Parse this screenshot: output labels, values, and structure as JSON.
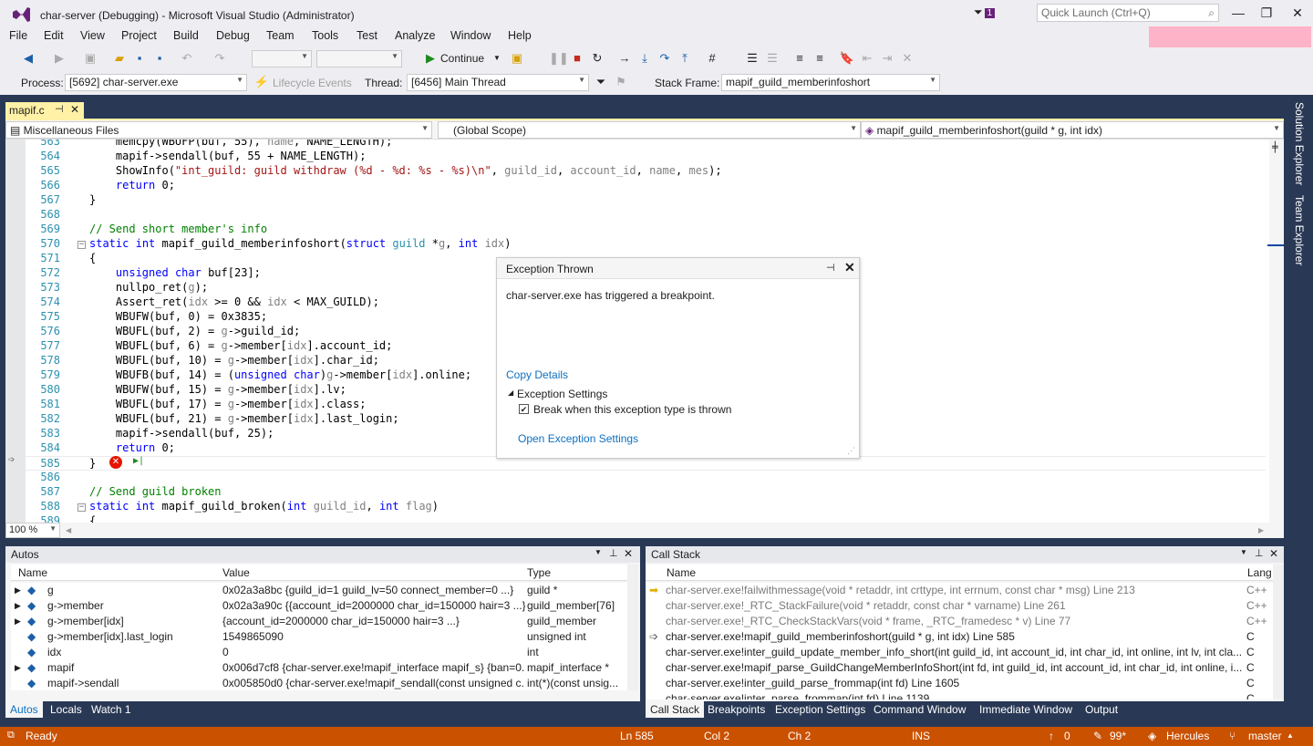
{
  "window": {
    "title": "char-server (Debugging) - Microsoft Visual Studio  (Administrator)",
    "notifications_badge": "1",
    "quick_launch_placeholder": "Quick Launch (Ctrl+Q)"
  },
  "menu": [
    "File",
    "Edit",
    "View",
    "Project",
    "Build",
    "Debug",
    "Team",
    "Tools",
    "Test",
    "Analyze",
    "Window",
    "Help"
  ],
  "toolbar": {
    "continue_label": "Continue",
    "process_label": "Process:",
    "process_value": "[5692] char-server.exe",
    "lifecycle_label": "Lifecycle Events",
    "thread_label": "Thread:",
    "thread_value": "[6456] Main Thread",
    "stackframe_label": "Stack Frame:",
    "stackframe_value": "mapif_guild_memberinfoshort"
  },
  "editor": {
    "tab_name": "mapif.c",
    "nav_project": "Miscellaneous Files",
    "nav_scope": "(Global Scope)",
    "nav_function": "mapif_guild_memberinfoshort(guild * g, int idx)",
    "zoom": "100 %",
    "lines": [
      {
        "n": "563",
        "html": "    memcpy(WBUFP(buf, 55), <span class=\"pm\">name</span>, NAME_LENGTH);"
      },
      {
        "n": "564",
        "html": "    mapif->sendall(buf, 55 + NAME_LENGTH);"
      },
      {
        "n": "565",
        "html": "    ShowInfo(<span class=\"st\">\"int_guild: guild withdraw (%d - %d: %s - %s)\\n\"</span>, <span class=\"pm\">guild_id</span>, <span class=\"pm\">account_id</span>, <span class=\"pm\">name</span>, <span class=\"pm\">mes</span>);"
      },
      {
        "n": "566",
        "html": "    <span class=\"kw\">return</span> 0;"
      },
      {
        "n": "567",
        "html": "}"
      },
      {
        "n": "568",
        "html": ""
      },
      {
        "n": "569",
        "html": "<span class=\"cm\">// Send short member's info</span>"
      },
      {
        "n": "570",
        "html": "<span class=\"kw\">static</span> <span class=\"kw\">int</span> mapif_guild_memberinfoshort(<span class=\"kw\">struct</span> <span class=\"ty\">guild</span> *<span class=\"pm\">g</span>, <span class=\"kw\">int</span> <span class=\"pm\">idx</span>)"
      },
      {
        "n": "571",
        "html": "{"
      },
      {
        "n": "572",
        "html": "    <span class=\"kw\">unsigned</span> <span class=\"kw\">char</span> buf[23];"
      },
      {
        "n": "573",
        "html": "    nullpo_ret(<span class=\"pm\">g</span>);"
      },
      {
        "n": "574",
        "html": "    Assert_ret(<span class=\"pm\">idx</span> >= 0 && <span class=\"pm\">idx</span> < MAX_GUILD);"
      },
      {
        "n": "575",
        "html": "    WBUFW(buf, 0) = 0x3835;"
      },
      {
        "n": "576",
        "html": "    WBUFL(buf, 2) = <span class=\"pm\">g</span>->guild_id;"
      },
      {
        "n": "577",
        "html": "    WBUFL(buf, 6) = <span class=\"pm\">g</span>->member[<span class=\"pm\">idx</span>].account_id;"
      },
      {
        "n": "578",
        "html": "    WBUFL(buf, 10) = <span class=\"pm\">g</span>->member[<span class=\"pm\">idx</span>].char_id;"
      },
      {
        "n": "579",
        "html": "    WBUFB(buf, 14) = (<span class=\"kw\">unsigned</span> <span class=\"kw\">char</span>)<span class=\"pm\">g</span>->member[<span class=\"pm\">idx</span>].online;"
      },
      {
        "n": "580",
        "html": "    WBUFW(buf, 15) = <span class=\"pm\">g</span>->member[<span class=\"pm\">idx</span>].lv;"
      },
      {
        "n": "581",
        "html": "    WBUFL(buf, 17) = <span class=\"pm\">g</span>->member[<span class=\"pm\">idx</span>].class;"
      },
      {
        "n": "582",
        "html": "    WBUFL(buf, 21) = <span class=\"pm\">g</span>->member[<span class=\"pm\">idx</span>].last_login;"
      },
      {
        "n": "583",
        "html": "    mapif->sendall(buf, 25);"
      },
      {
        "n": "584",
        "html": "    <span class=\"kw\">return</span> 0;"
      },
      {
        "n": "585",
        "html": "}"
      },
      {
        "n": "586",
        "html": ""
      },
      {
        "n": "587",
        "html": "<span class=\"cm\">// Send guild broken</span>"
      },
      {
        "n": "588",
        "html": "<span class=\"kw\">static</span> <span class=\"kw\">int</span> mapif_guild_broken(<span class=\"kw\">int</span> <span class=\"pm\">guild_id</span>, <span class=\"kw\">int</span> <span class=\"pm\">flag</span>)"
      },
      {
        "n": "589",
        "html": "{"
      }
    ]
  },
  "exception_popup": {
    "title": "Exception Thrown",
    "message": "char-server.exe has triggered a breakpoint.",
    "copy_details": "Copy Details",
    "settings_header": "Exception Settings",
    "break_checkbox_label": "Break when this exception type is thrown",
    "break_checked": true,
    "open_settings": "Open Exception Settings"
  },
  "autos": {
    "title": "Autos",
    "columns": [
      "Name",
      "Value",
      "Type"
    ],
    "rows": [
      {
        "name": "g",
        "value": "0x02a3a8bc {guild_id=1 guild_lv=50 connect_member=0 ...}",
        "type": "guild *",
        "expand": true
      },
      {
        "name": "g->member",
        "value": "0x02a3a90c {{account_id=2000000 char_id=150000 hair=3 ...},...",
        "type": "guild_member[76]",
        "expand": true
      },
      {
        "name": "g->member[idx]",
        "value": "{account_id=2000000 char_id=150000 hair=3 ...}",
        "type": "guild_member",
        "expand": true
      },
      {
        "name": "g->member[idx].last_login",
        "value": "1549865090",
        "type": "unsigned int",
        "expand": false
      },
      {
        "name": "idx",
        "value": "0",
        "type": "int",
        "expand": false
      },
      {
        "name": "mapif",
        "value": "0x006d7cf8 {char-server.exe!mapif_interface mapif_s} {ban=0...",
        "type": "mapif_interface *",
        "expand": true
      },
      {
        "name": "mapif->sendall",
        "value": "0x005850d0 {char-server.exe!mapif_sendall(const unsigned c...",
        "type": "int(*)(const unsig...",
        "expand": false
      }
    ],
    "tabs": [
      "Autos",
      "Locals",
      "Watch 1"
    ]
  },
  "callstack": {
    "title": "Call Stack",
    "columns": [
      "Name",
      "Lang"
    ],
    "rows": [
      {
        "name": "char-server.exe!failwithmessage(void * retaddr, int crttype, int errnum, const char * msg) Line 213",
        "lang": "C++",
        "grey": true,
        "marker": "current"
      },
      {
        "name": "char-server.exe!_RTC_StackFailure(void * retaddr, const char * varname) Line 261",
        "lang": "C++",
        "grey": true,
        "marker": ""
      },
      {
        "name": "char-server.exe!_RTC_CheckStackVars(void * frame, _RTC_framedesc * v) Line 77",
        "lang": "C++",
        "grey": true,
        "marker": ""
      },
      {
        "name": "char-server.exe!mapif_guild_memberinfoshort(guild * g, int idx) Line 585",
        "lang": "C",
        "grey": false,
        "marker": "return"
      },
      {
        "name": "char-server.exe!inter_guild_update_member_info_short(int guild_id, int account_id, int char_id, int online, int lv, int cla...",
        "lang": "C",
        "grey": false,
        "marker": ""
      },
      {
        "name": "char-server.exe!mapif_parse_GuildChangeMemberInfoShort(int fd, int guild_id, int account_id, int char_id, int online, i...",
        "lang": "C",
        "grey": false,
        "marker": ""
      },
      {
        "name": "char-server.exe!inter_guild_parse_frommap(int fd) Line 1605",
        "lang": "C",
        "grey": false,
        "marker": ""
      },
      {
        "name": "char-server.exe!inter_parse_frommap(int fd) Line 1139",
        "lang": "C",
        "grey": false,
        "marker": ""
      }
    ],
    "tabs": [
      "Call Stack",
      "Breakpoints",
      "Exception Settings",
      "Command Window",
      "Immediate Window",
      "Output"
    ]
  },
  "side_tabs": [
    "Solution Explorer",
    "Team Explorer"
  ],
  "status": {
    "ready": "Ready",
    "ln": "Ln 585",
    "col": "Col 2",
    "ch": "Ch 2",
    "ins": "INS",
    "up_count": "0",
    "pencil_count": "99*",
    "repo": "Hercules",
    "branch": "master"
  },
  "colors": {
    "accent": "#68217a",
    "status_bar": "#ca5100",
    "tab_active": "#fff1a6",
    "dock_bg": "#293955"
  }
}
